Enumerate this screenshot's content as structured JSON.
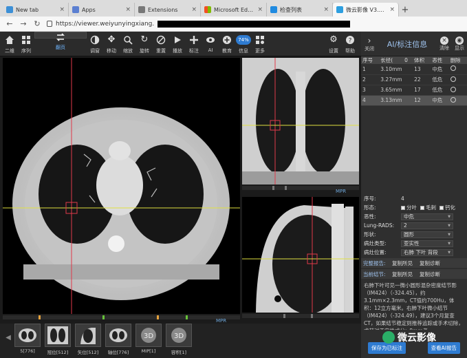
{
  "browser": {
    "tabs": [
      {
        "title": "New tab",
        "favicon": "edge-icon",
        "color": "#3c8fd6"
      },
      {
        "title": "Apps",
        "favicon": "apps-icon",
        "color": "#5b7fd1"
      },
      {
        "title": "Extensions",
        "favicon": "extensions-icon",
        "color": "#777777"
      },
      {
        "title": "Microsoft Edge Insider",
        "favicon": "microsoft-icon",
        "color": "#f25022"
      },
      {
        "title": "检查列表",
        "favicon": "list-icon",
        "color": "#1f8ae0"
      },
      {
        "title": "微云影像 V3.10.2---临…",
        "favicon": "app-icon",
        "color": "#2d9fe0"
      }
    ],
    "url": "https://viewer.weiyunyingxiang."
  },
  "toolbar": {
    "buttons": [
      {
        "label": "二维",
        "icon": "home-icon"
      },
      {
        "label": "序列",
        "icon": "grid-icon"
      },
      {
        "label": "翻页",
        "icon": "page-icon",
        "selected": true
      },
      {
        "label": "调窗",
        "icon": "contrast-icon"
      },
      {
        "label": "移动",
        "icon": "move-icon"
      },
      {
        "label": "缩放",
        "icon": "zoom-icon"
      },
      {
        "label": "旋转",
        "icon": "rotate-icon"
      },
      {
        "label": "重置",
        "icon": "reset-icon"
      },
      {
        "label": "播放",
        "icon": "play-icon"
      },
      {
        "label": "标注",
        "icon": "annotate-icon"
      },
      {
        "label": "AI",
        "icon": "eye-icon"
      },
      {
        "label": "教育",
        "icon": "plus-circle-icon"
      },
      {
        "label": "信息",
        "icon": "info-icon",
        "badge": "74%"
      },
      {
        "label": "更多",
        "icon": "more-icon"
      }
    ],
    "right": [
      {
        "label": "设置",
        "icon": "gear-icon"
      },
      {
        "label": "帮助",
        "icon": "help-icon"
      }
    ]
  },
  "ai_panel": {
    "close_label": "关闭",
    "title": "AI/标注信息",
    "clear_label": "清除",
    "hide_label": "显示",
    "table_headers": [
      "序号",
      "长径(",
      "0",
      "体积",
      "恶性",
      "删除"
    ],
    "rows": [
      {
        "idx": "1",
        "diameter": "3.10mm",
        "volume": "13",
        "risk": "中危",
        "risk_level": "mid"
      },
      {
        "idx": "2",
        "diameter": "3.27mm",
        "volume": "22",
        "risk": "低危",
        "risk_level": "low"
      },
      {
        "idx": "3",
        "diameter": "3.65mm",
        "volume": "17",
        "risk": "低危",
        "risk_level": "low"
      },
      {
        "idx": "4",
        "diameter": "3.13mm",
        "volume": "12",
        "risk": "中危",
        "risk_level": "mid",
        "selected": true
      }
    ],
    "props": {
      "seq_label": "序号:",
      "seq_value": "4",
      "shape_label": "形态:",
      "shape_opts": [
        "分叶",
        "毛刺",
        "钙化"
      ],
      "malig_label": "恶性:",
      "malig_value": "中危",
      "lungrads_label": "Lung-RADS:",
      "lungrads_value": "2",
      "form_label": "形状:",
      "form_value": "圆形",
      "type_label": "病灶类型:",
      "type_value": "亚实性",
      "pos_label": "病灶位置:",
      "pos_value": "右肺 下叶 背段"
    },
    "report_full": {
      "label": "完整报告:",
      "copy": "复制所见",
      "copy_diag": "复制诊断"
    },
    "report_current": {
      "label": "当前结节:",
      "copy": "复制所见",
      "copy_diag": "复制诊断"
    },
    "report_text": "右肺下叶可见一微小圆形混杂密度结节影（IM424）（-324.45），约3.1mm×2.3mm，CT值约700Hu，体积：12立方毫米。右肺下叶微小结节（IM424）（-324.49），建议3个月复查CT，如果结节稳定则推荐追踪或手术切除，尤其对于实性成分>8mm者。",
    "btn_save": "保存为已标注",
    "btn_submit": "查看AI报告"
  },
  "viewports": {
    "mpr_label": "MPR"
  },
  "thumbnails": [
    {
      "label": "5[776]",
      "icon": "axial-thumb-icon"
    },
    {
      "label": "冠位[512]",
      "icon": "coronal-thumb-icon"
    },
    {
      "label": "矢位[512]",
      "icon": "sagittal-thumb-icon"
    },
    {
      "label": "轴位[776]",
      "icon": "axial-thumb-icon"
    },
    {
      "label": "MIP[1]",
      "icon": "3d-thumb-icon"
    },
    {
      "label": "容积[1]",
      "icon": "3d-thumb-icon"
    }
  ],
  "watermark": "微云影像"
}
